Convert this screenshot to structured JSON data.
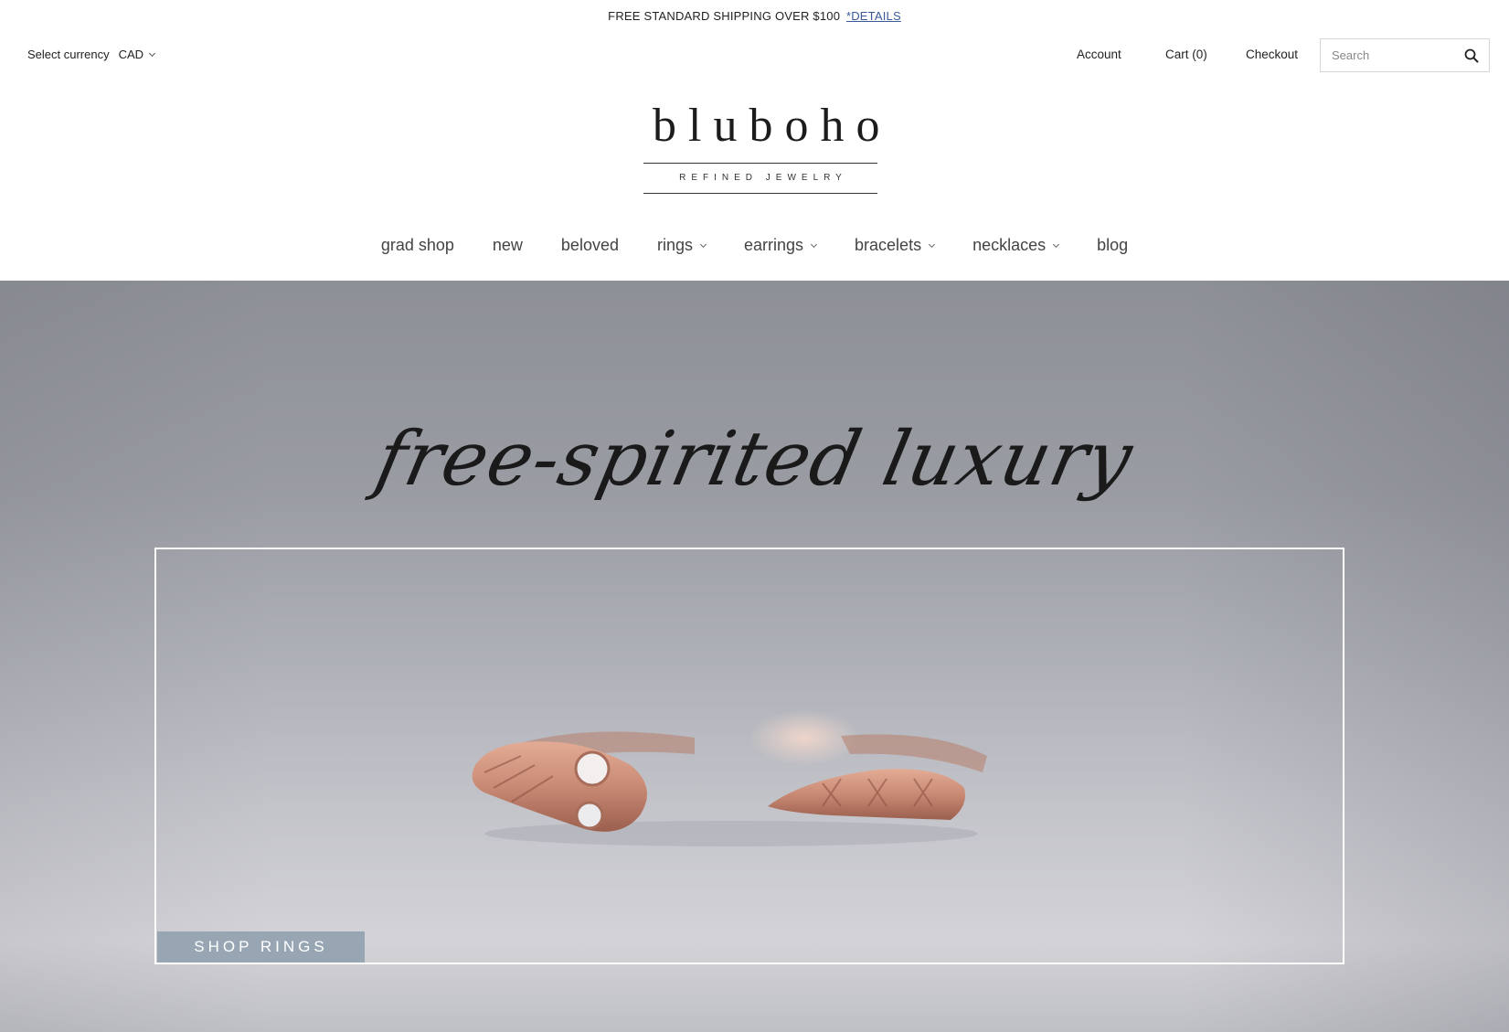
{
  "announcement": {
    "text": "FREE STANDARD SHIPPING OVER $100",
    "link": "*DETAILS"
  },
  "currency": {
    "label": "Select currency",
    "value": "CAD"
  },
  "utility": {
    "account": "Account",
    "cart": "Cart (0)",
    "checkout": "Checkout",
    "search_placeholder": "Search"
  },
  "logo": {
    "name": "bluboho",
    "tagline": "REFINED JEWELRY"
  },
  "nav": [
    {
      "label": "grad shop",
      "dropdown": false
    },
    {
      "label": "new",
      "dropdown": false
    },
    {
      "label": "beloved",
      "dropdown": false
    },
    {
      "label": "rings",
      "dropdown": true
    },
    {
      "label": "earrings",
      "dropdown": true
    },
    {
      "label": "bracelets",
      "dropdown": true
    },
    {
      "label": "necklaces",
      "dropdown": true
    },
    {
      "label": "blog",
      "dropdown": false
    }
  ],
  "hero": {
    "tagline": "free-spirited luxury",
    "cta": "SHOP RINGS"
  },
  "colors": {
    "cta_bg": "#98a6b4",
    "link": "#3a5a98",
    "ring": "#c98a74"
  }
}
